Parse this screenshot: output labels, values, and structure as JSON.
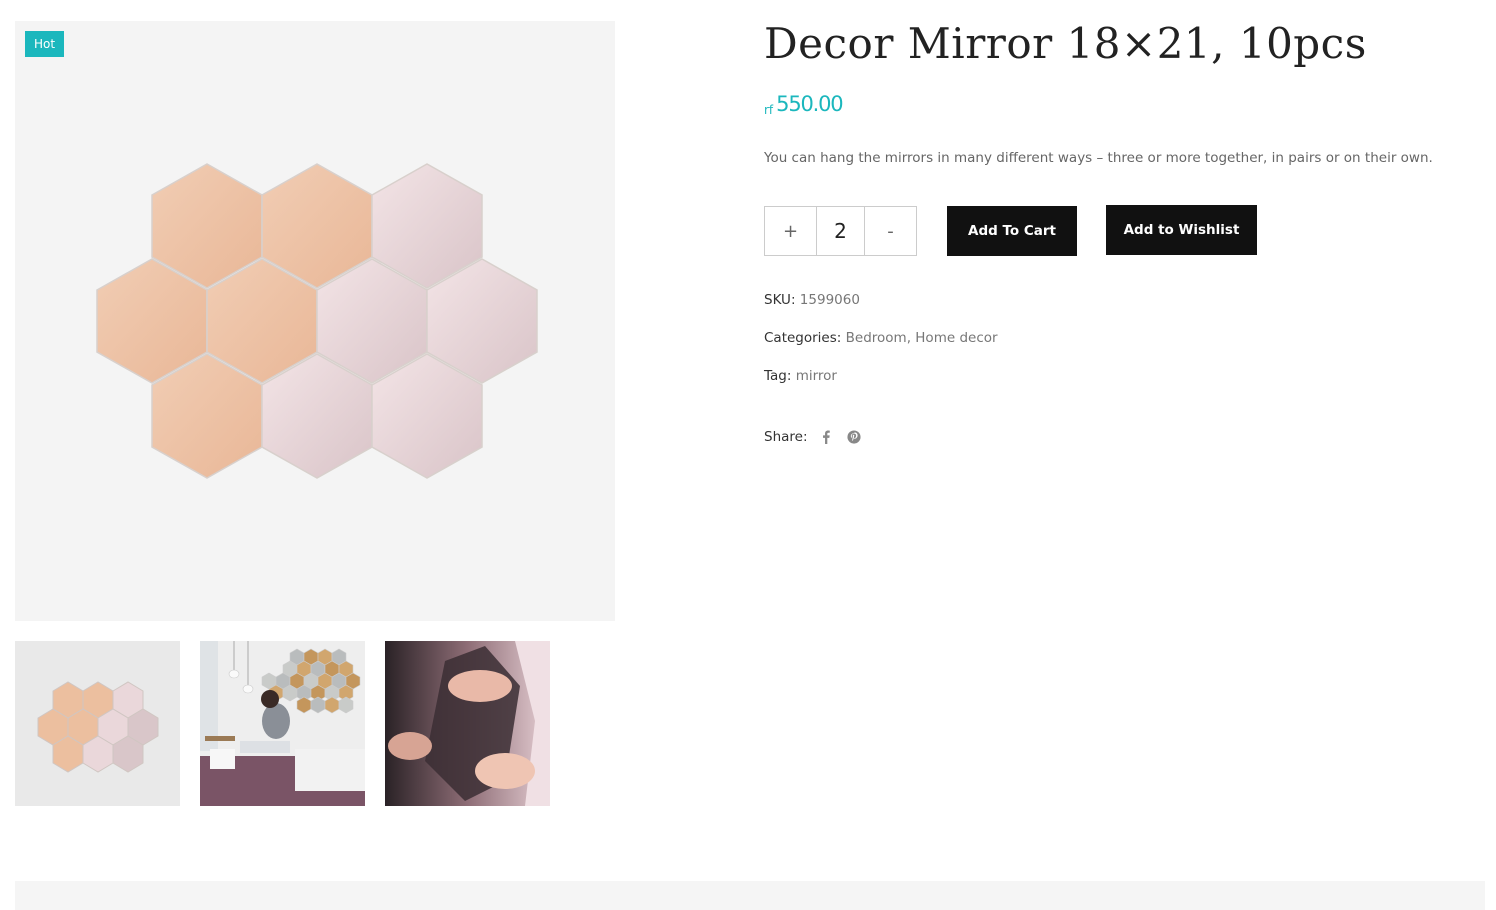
{
  "product": {
    "badge": "Hot",
    "title": "Decor Mirror 18×21, 10pcs",
    "price_currency": "rf",
    "price_amount": "550.00",
    "description": "You can hang the mirrors in many different ways – three or more together, in pairs or on their own."
  },
  "quantity": {
    "increase": "+",
    "value": "2",
    "decrease": "-"
  },
  "actions": {
    "add_to_cart": "Add To Cart",
    "add_to_wishlist": "Add to Wishlist"
  },
  "meta": {
    "sku_label": "SKU:",
    "sku_value": "1599060",
    "categories_label": "Categories:",
    "categories": [
      "Bedroom",
      "Home decor"
    ],
    "separator": ",",
    "tag_label": "Tag:",
    "tag_value": "mirror",
    "share_label": "Share:"
  },
  "share_icons": [
    "facebook-icon",
    "pinterest-icon"
  ],
  "colors": {
    "accent": "#1bb7bd",
    "button": "#111111",
    "copper": "#efc4a8",
    "pink": "#efdadd"
  }
}
